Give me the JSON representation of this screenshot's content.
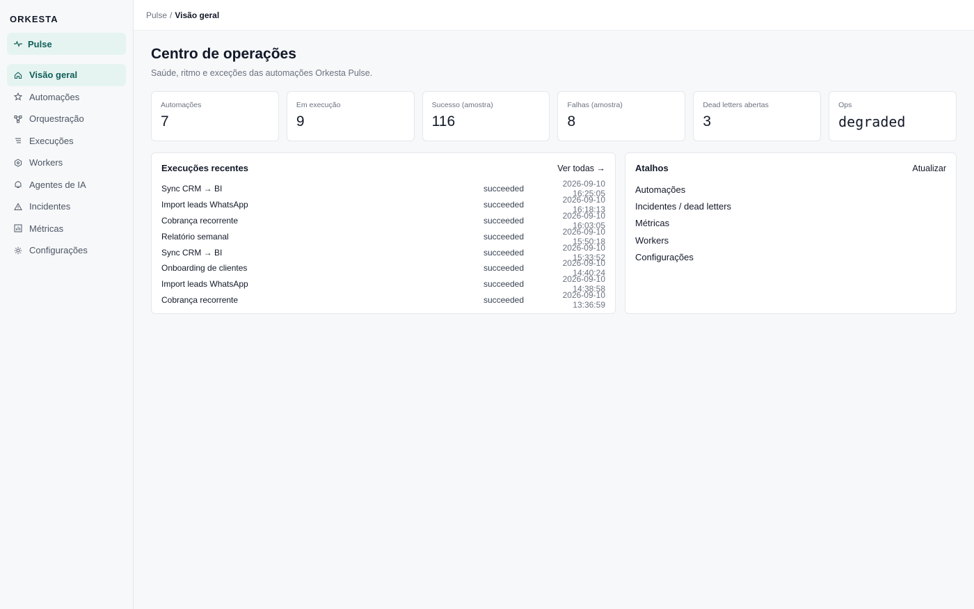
{
  "sidebar": {
    "brand": "ORKESTA",
    "product": "Pulse",
    "items": [
      {
        "label": "Visão geral",
        "icon": "home-icon"
      },
      {
        "label": "Automações",
        "icon": "star-icon"
      },
      {
        "label": "Orquestração",
        "icon": "flow-icon"
      },
      {
        "label": "Execuções",
        "icon": "list-icon"
      },
      {
        "label": "Workers",
        "icon": "hexagon-icon"
      },
      {
        "label": "Agentes de IA",
        "icon": "bot-icon"
      },
      {
        "label": "Incidentes",
        "icon": "warning-icon"
      },
      {
        "label": "Métricas",
        "icon": "chart-icon"
      },
      {
        "label": "Configurações",
        "icon": "gear-icon"
      }
    ],
    "active_index": 0
  },
  "breadcrumb": {
    "root": "Pulse",
    "separator": "/",
    "current": "Visão geral"
  },
  "page": {
    "title": "Centro de operações",
    "subtitle": "Saúde, ritmo e exceções das automações Orkesta Pulse."
  },
  "stats": [
    {
      "label": "Automações",
      "value": "7"
    },
    {
      "label": "Em execução",
      "value": "9"
    },
    {
      "label": "Sucesso (amostra)",
      "value": "116"
    },
    {
      "label": "Falhas (amostra)",
      "value": "8"
    },
    {
      "label": "Dead letters abertas",
      "value": "3"
    },
    {
      "label": "Ops",
      "value": "degraded"
    }
  ],
  "recent": {
    "title": "Execuções recentes",
    "link": "Ver todas →",
    "rows": [
      {
        "name": "Sync CRM → BI",
        "status": "succeeded",
        "time": "2026-09-10 16:25:05"
      },
      {
        "name": "Import leads WhatsApp",
        "status": "succeeded",
        "time": "2026-09-10 16:18:13"
      },
      {
        "name": "Cobrança recorrente",
        "status": "succeeded",
        "time": "2026-09-10 16:03:05"
      },
      {
        "name": "Relatório semanal",
        "status": "succeeded",
        "time": "2026-09-10 15:50:18"
      },
      {
        "name": "Sync CRM → BI",
        "status": "succeeded",
        "time": "2026-09-10 15:33:52"
      },
      {
        "name": "Onboarding de clientes",
        "status": "succeeded",
        "time": "2026-09-10 14:40:24"
      },
      {
        "name": "Import leads WhatsApp",
        "status": "succeeded",
        "time": "2026-09-10 14:38:58"
      },
      {
        "name": "Cobrança recorrente",
        "status": "succeeded",
        "time": "2026-09-10 13:36:59"
      }
    ]
  },
  "shortcuts": {
    "title": "Atalhos",
    "refresh": "Atualizar",
    "items": [
      "Automações",
      "Incidentes / dead letters",
      "Métricas",
      "Workers",
      "Configurações"
    ]
  },
  "colors": {
    "accent": "#0f5e57",
    "accent_bg": "#e6f4f1"
  }
}
